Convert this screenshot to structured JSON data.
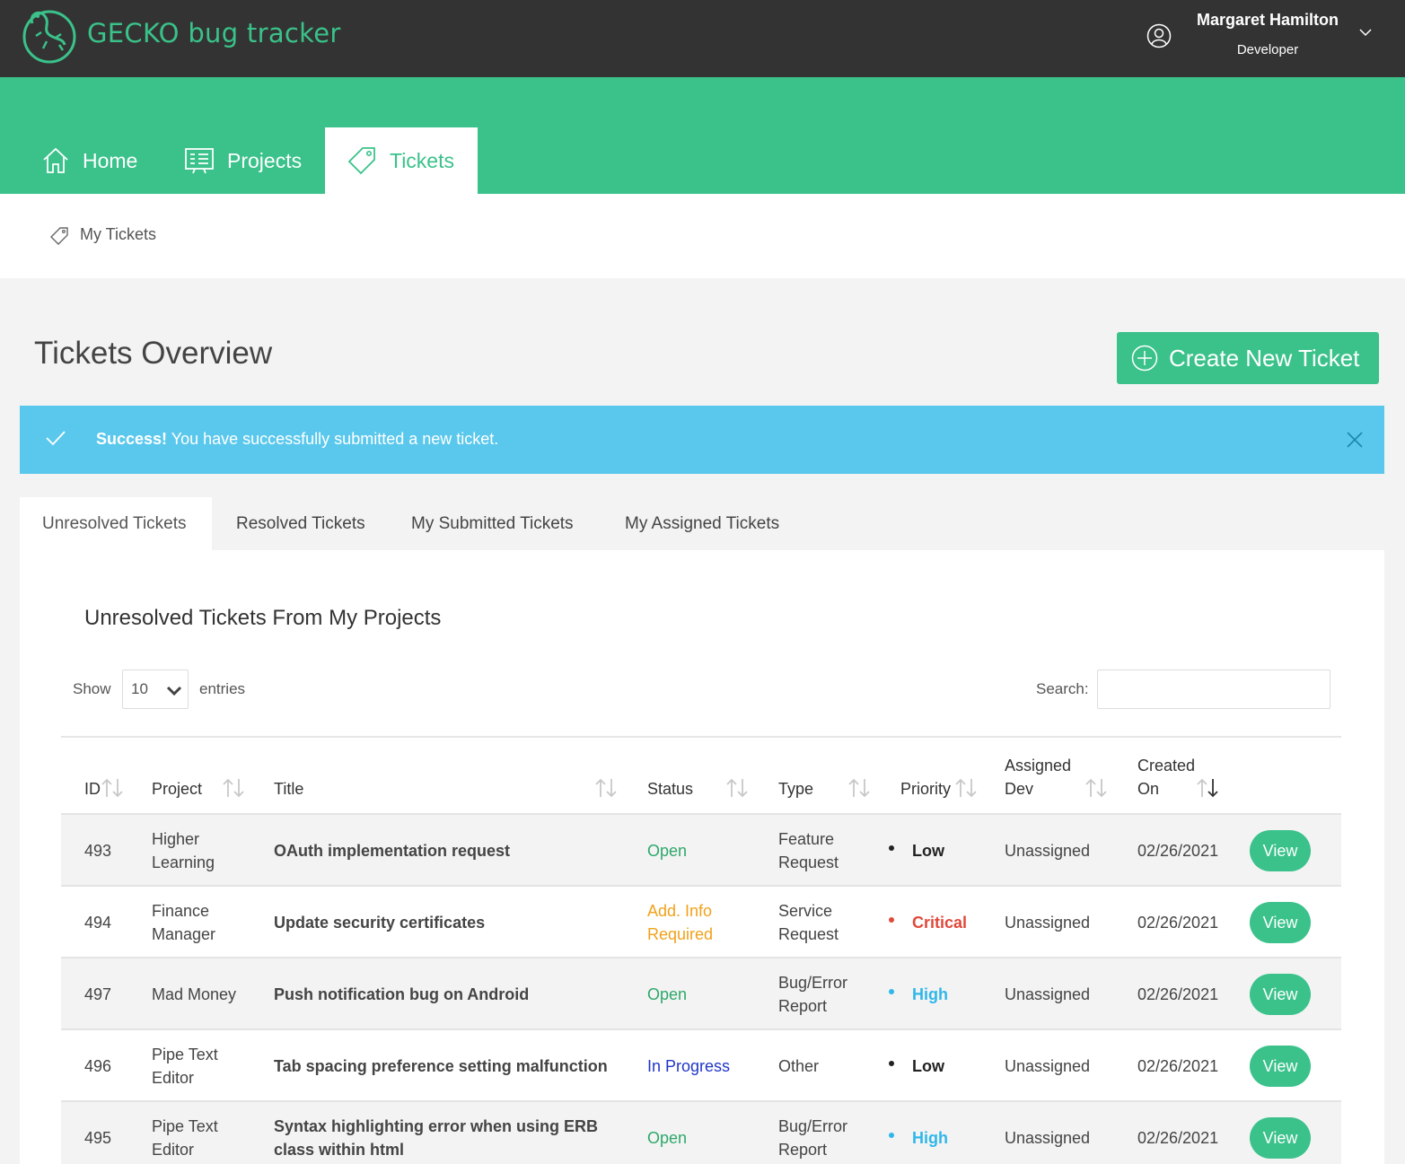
{
  "app": {
    "brand": "GECKO bug tracker",
    "user_name": "Margaret Hamilton",
    "user_role": "Developer"
  },
  "nav": {
    "home": "Home",
    "projects": "Projects",
    "tickets": "Tickets"
  },
  "breadcrumb": "My Tickets",
  "page": {
    "title": "Tickets Overview",
    "create_button": "Create New Ticket"
  },
  "alert": {
    "strong": "Success!",
    "message": " You have successfully submitted a new ticket."
  },
  "tabs": [
    "Unresolved Tickets",
    "Resolved Tickets",
    "My Submitted Tickets",
    "My Assigned Tickets"
  ],
  "panel": {
    "title": "Unresolved Tickets From My Projects",
    "show_label": "Show",
    "show_value": "10",
    "entries_label": "entries",
    "search_label": "Search:",
    "search_value": ""
  },
  "columns": {
    "id": "ID",
    "project": "Project",
    "title": "Title",
    "status": "Status",
    "type": "Type",
    "priority": "Priority",
    "assigned_1": "Assigned",
    "assigned_2": "Dev",
    "created_1": "Created",
    "created_2": "On"
  },
  "rows": [
    {
      "id": "493",
      "project": "Higher Learning",
      "title": "OAuth implementation request",
      "status": "Open",
      "type": "Feature Request",
      "priority": "Low",
      "assigned": "Unassigned",
      "created": "02/26/2021",
      "action": "View"
    },
    {
      "id": "494",
      "project": "Finance Manager",
      "title": "Update security certificates",
      "status": "Add. Info Required",
      "type": "Service Request",
      "priority": "Critical",
      "assigned": "Unassigned",
      "created": "02/26/2021",
      "action": "View"
    },
    {
      "id": "497",
      "project": "Mad Money",
      "title": "Push notification bug on Android",
      "status": "Open",
      "type": "Bug/Error Report",
      "priority": "High",
      "assigned": "Unassigned",
      "created": "02/26/2021",
      "action": "View"
    },
    {
      "id": "496",
      "project": "Pipe Text Editor",
      "title": "Tab spacing preference setting malfunction",
      "status": "In Progress",
      "type": "Other",
      "priority": "Low",
      "assigned": "Unassigned",
      "created": "02/26/2021",
      "action": "View"
    },
    {
      "id": "495",
      "project": "Pipe Text Editor",
      "title": "Syntax highlighting error when using ERB class within html",
      "status": "Open",
      "type": "Bug/Error Report",
      "priority": "High",
      "assigned": "Unassigned",
      "created": "02/26/2021",
      "action": "View"
    }
  ],
  "colors": {
    "brand": "#3ac28a",
    "topbar": "#333333",
    "alert": "#5ac8ec",
    "status_open": "#2ea86a",
    "status_info": "#f0a21b",
    "status_progress": "#2236c8",
    "priority_low": "#222222",
    "priority_critical": "#e0493a",
    "priority_high": "#2fb7ea"
  }
}
